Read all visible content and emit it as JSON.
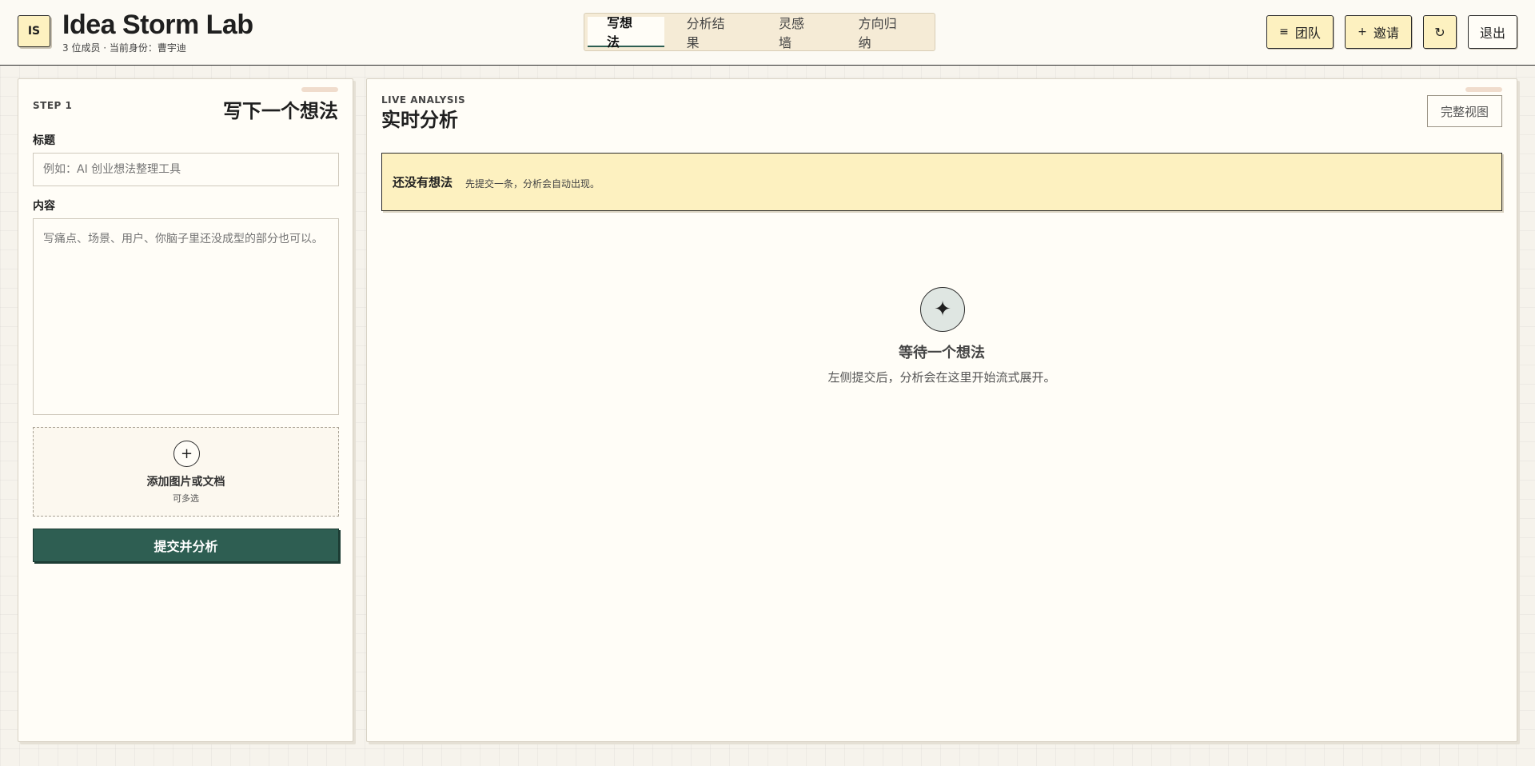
{
  "header": {
    "logo": "IS",
    "title": "Idea Storm Lab",
    "subtitle": "3 位成员 · 当前身份：曹宇迪",
    "tabs": [
      {
        "label": "写想法"
      },
      {
        "label": "分析结果"
      },
      {
        "label": "灵感墙"
      },
      {
        "label": "方向归纳"
      }
    ],
    "team_label": "团队",
    "invite_label": "邀请",
    "refresh_icon": "↻",
    "logout_label": "退出"
  },
  "composer": {
    "step": "STEP 1",
    "title": "写下一个想法",
    "title_label": "标题",
    "title_placeholder": "例如：AI 创业想法整理工具",
    "content_label": "内容",
    "content_placeholder": "写痛点、场景、用户、你脑子里还没成型的部分也可以。",
    "upload_label": "添加图片或文档",
    "upload_sub": "可多选",
    "submit_label": "提交并分析"
  },
  "analysis": {
    "eyebrow": "LIVE ANALYSIS",
    "title": "实时分析",
    "full_view_label": "完整视图",
    "notice_title": "还没有想法",
    "notice_sub": "先提交一条，分析会自动出现。",
    "empty_title": "等待一个想法",
    "empty_sub": "左侧提交后，分析会在这里开始流式展开。"
  },
  "colors": {
    "accent": "#2e5e52",
    "highlight": "#fdf1c0",
    "background": "#f6f3ec"
  }
}
